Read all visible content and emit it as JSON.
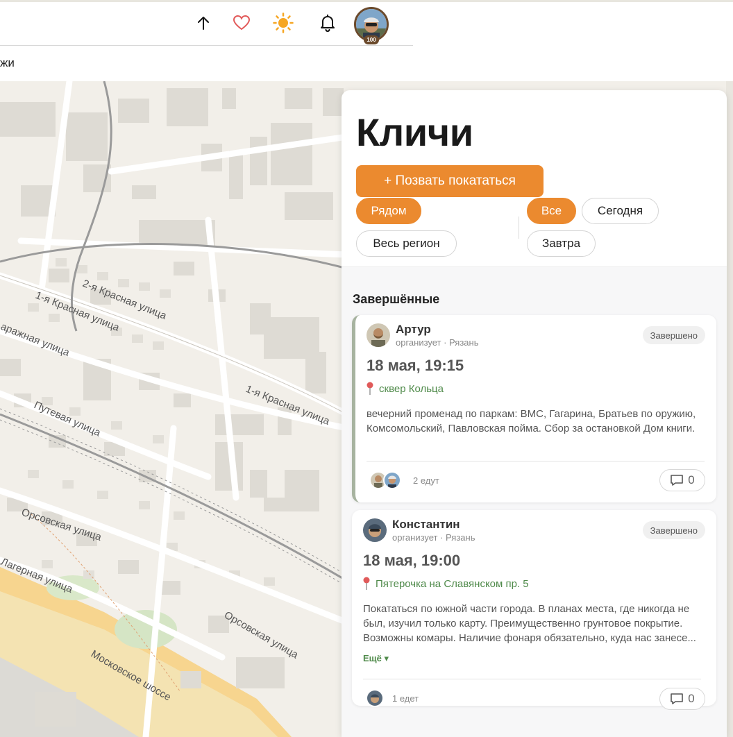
{
  "header": {
    "icons": [
      "arrow-up-icon",
      "heart-icon",
      "sun-icon",
      "bell-icon"
    ],
    "avatar_badge": "100"
  },
  "subbar": {
    "text": "жи"
  },
  "map": {
    "streets": [
      "2-я Красная улица",
      "1-я Красная улица",
      "1-я Красная улица",
      "аражная улица",
      "Путевая улица",
      "Орсовская улица",
      "Лагерная улица",
      "Орсовская улица",
      "Московское шоссе"
    ]
  },
  "panel": {
    "title": "Кличи",
    "primary_button": "+ Позвать покататься",
    "filters_area": [
      "Рядом",
      "Весь регион"
    ],
    "filters_time": [
      "Все",
      "Сегодня",
      "Завтра"
    ],
    "section_title": "Завершённые",
    "cards": [
      {
        "name": "Артур",
        "meta": "организует · Рязань",
        "badge": "Завершено",
        "date": "18 мая, 19:15",
        "location": "сквер Кольца",
        "description": "вечерний променад по паркам: ВМС, Гагарина, Братьев по оружию, Комсомольский, Павловская пойма.  Сбор за остановкой Дом книги.",
        "riders_text": "2 едут",
        "comments": "0"
      },
      {
        "name": "Константин",
        "meta": "организует · Рязань",
        "badge": "Завершено",
        "date": "18 мая, 19:00",
        "location": "Пятерочка на Славянском пр. 5",
        "description": "Покататься по южной части города. В планах места, где никогда не был, изучил только карту. Преимущественно грунтовое покрытие. Возможны комары. Наличие фонаря обязательно, куда нас занесе...",
        "more": "Ещё ▾",
        "riders_text": "1 едет",
        "comments": "0"
      }
    ]
  },
  "colors": {
    "accent": "#eb8a2f",
    "location_green": "#4f8a4a",
    "map_background": "#f2efe9"
  }
}
